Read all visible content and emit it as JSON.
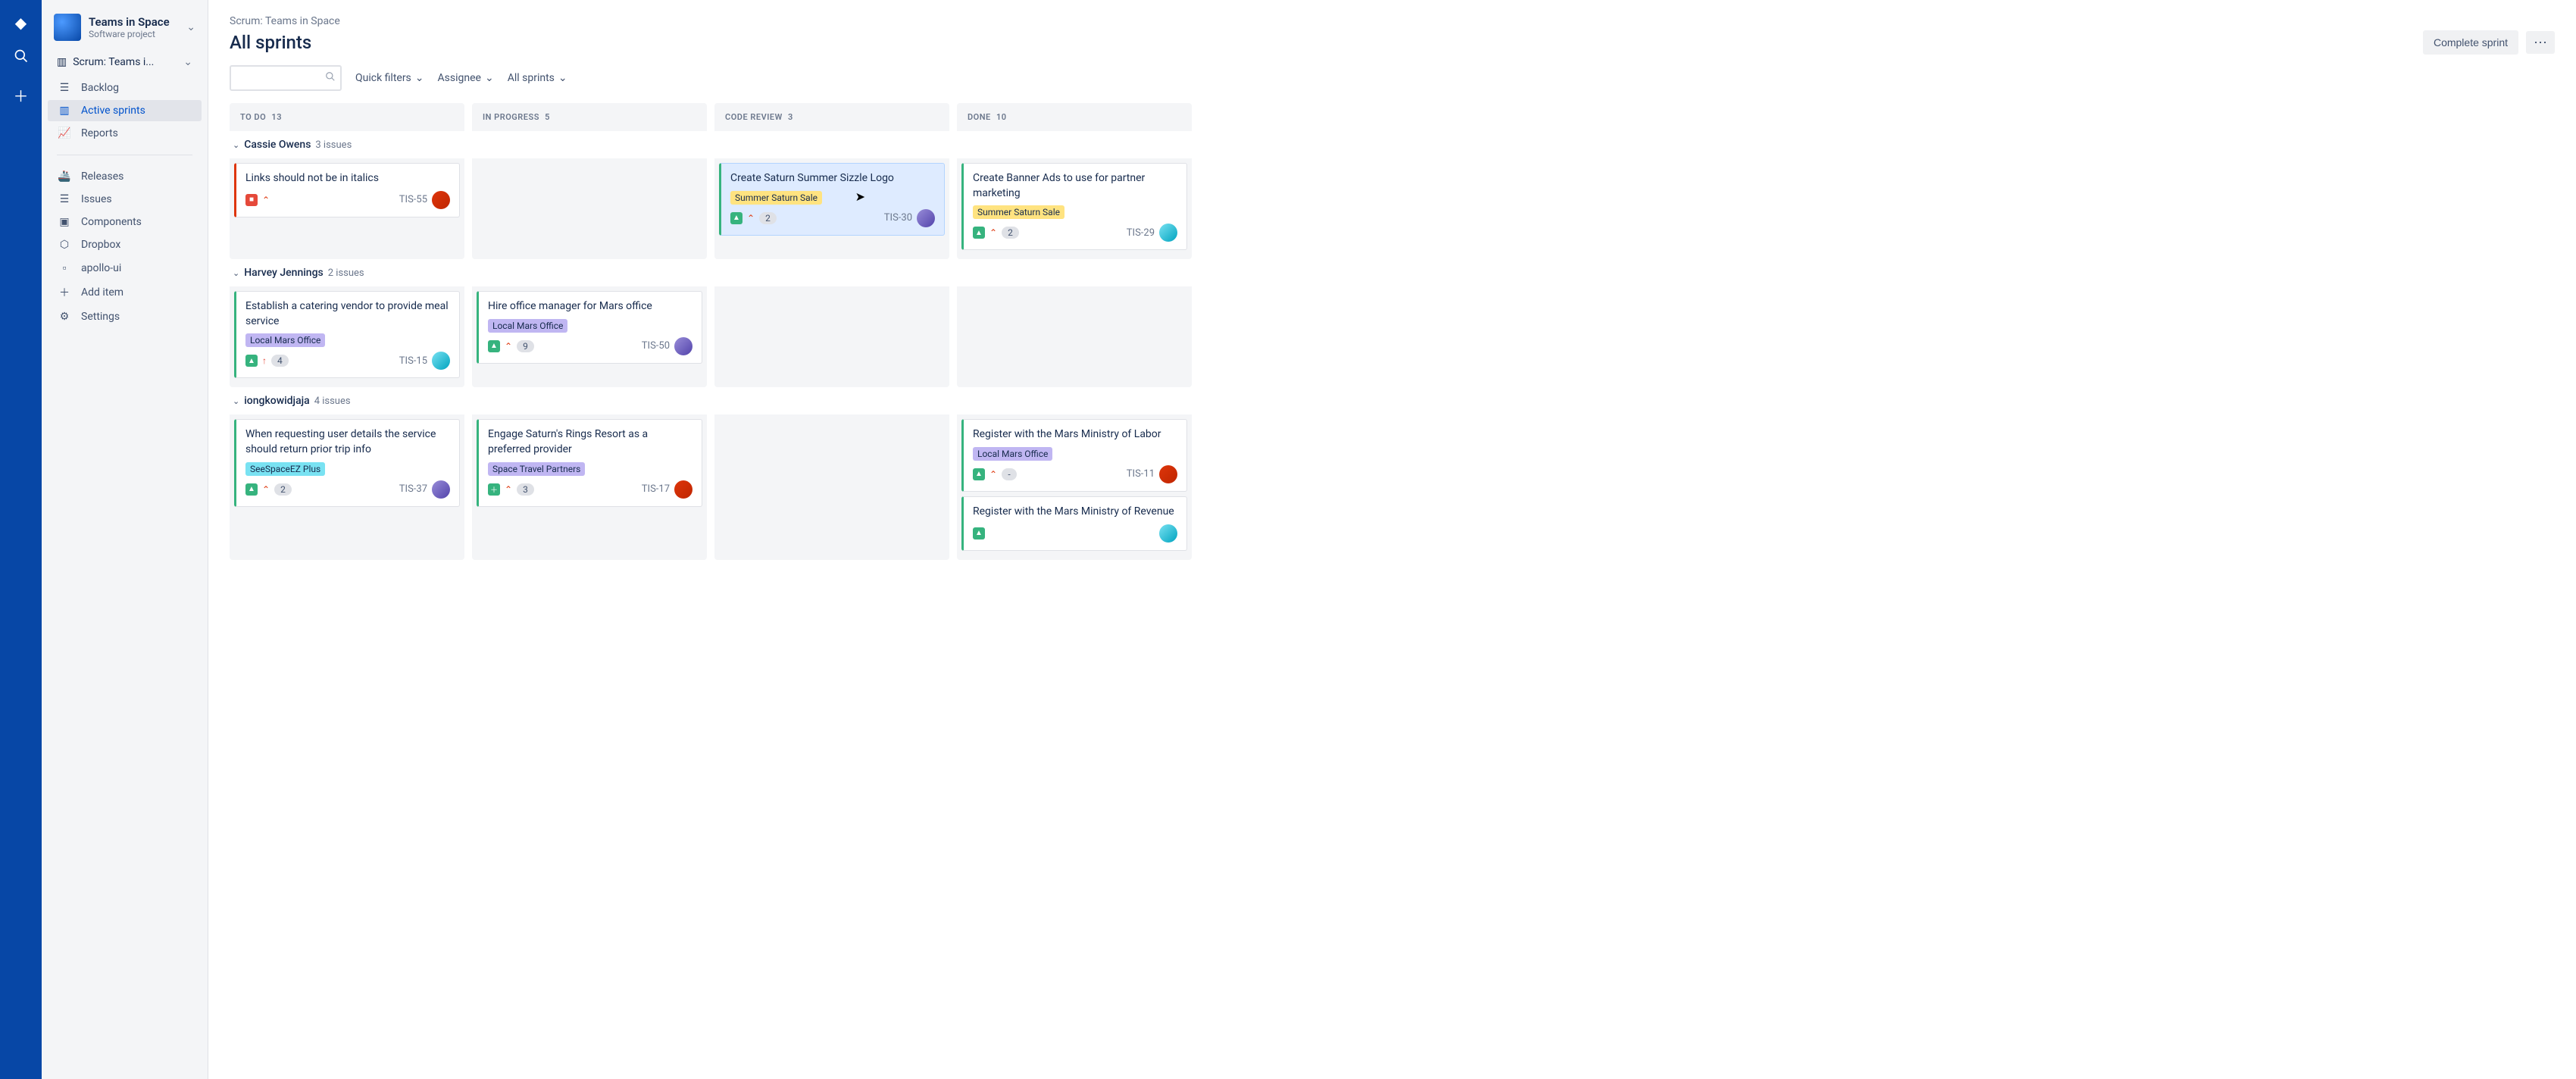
{
  "project": {
    "name": "Teams in Space",
    "type": "Software project"
  },
  "sidebar": {
    "board_selector": "Scrum: Teams i...",
    "items": [
      "Backlog",
      "Active sprints",
      "Reports"
    ],
    "sec": [
      "Releases",
      "Issues",
      "Components",
      "Dropbox",
      "apollo-ui",
      "Add item",
      "Settings"
    ]
  },
  "breadcrumb": "Scrum: Teams in Space",
  "title": "All sprints",
  "actions": {
    "complete": "Complete sprint"
  },
  "filters": {
    "quick": "Quick filters",
    "assignee": "Assignee",
    "sprints": "All sprints"
  },
  "columns": [
    {
      "name": "TO DO",
      "count": "13"
    },
    {
      "name": "IN PROGRESS",
      "count": "5"
    },
    {
      "name": "CODE REVIEW",
      "count": "3"
    },
    {
      "name": "DONE",
      "count": "10"
    }
  ],
  "swimlanes": [
    {
      "name": "Cassie Owens",
      "count": "3 issues",
      "cards": {
        "todo": [
          {
            "title": "Links should not be in italics",
            "key": "TIS-55",
            "type": "bug",
            "prio": "highest"
          }
        ],
        "progress": [],
        "review": [
          {
            "title": "Create Saturn Summer Sizzle Logo",
            "tag": "Summer Saturn Sale",
            "tagClass": "yellow",
            "key": "TIS-30",
            "type": "story",
            "prio": "highest",
            "est": "2",
            "selected": true
          }
        ],
        "done": [
          {
            "title": "Create Banner Ads to use for partner marketing",
            "tag": "Summer Saturn Sale",
            "tagClass": "yellow",
            "key": "TIS-29",
            "type": "story",
            "prio": "highest",
            "est": "2"
          }
        ]
      }
    },
    {
      "name": "Harvey Jennings",
      "count": "2 issues",
      "cards": {
        "todo": [
          {
            "title": "Establish a catering vendor to provide meal service",
            "tag": "Local Mars Office",
            "tagClass": "purple",
            "key": "TIS-15",
            "type": "story",
            "prio": "high",
            "est": "4"
          }
        ],
        "progress": [
          {
            "title": "Hire office manager for Mars office",
            "tag": "Local Mars Office",
            "tagClass": "purple",
            "key": "TIS-50",
            "type": "story",
            "prio": "highest",
            "est": "9"
          }
        ],
        "review": [],
        "done": []
      }
    },
    {
      "name": "iongkowidjaja",
      "count": "4 issues",
      "cards": {
        "todo": [
          {
            "title": "When requesting user details the service should return prior trip info",
            "tag": "SeeSpaceEZ Plus",
            "tagClass": "teal",
            "key": "TIS-37",
            "type": "story",
            "prio": "highest",
            "est": "2"
          }
        ],
        "progress": [
          {
            "title": "Engage Saturn's Rings Resort as a preferred provider",
            "tag": "Space Travel Partners",
            "tagClass": "purple",
            "key": "TIS-17",
            "type": "new",
            "prio": "highest",
            "est": "3"
          }
        ],
        "review": [],
        "done": [
          {
            "title": "Register with the Mars Ministry of Labor",
            "tag": "Local Mars Office",
            "tagClass": "purple",
            "key": "TIS-11",
            "type": "story",
            "prio": "highest",
            "est": "-"
          },
          {
            "title": "Register with the Mars Ministry of Revenue",
            "key": "",
            "type": "story"
          }
        ]
      }
    }
  ]
}
